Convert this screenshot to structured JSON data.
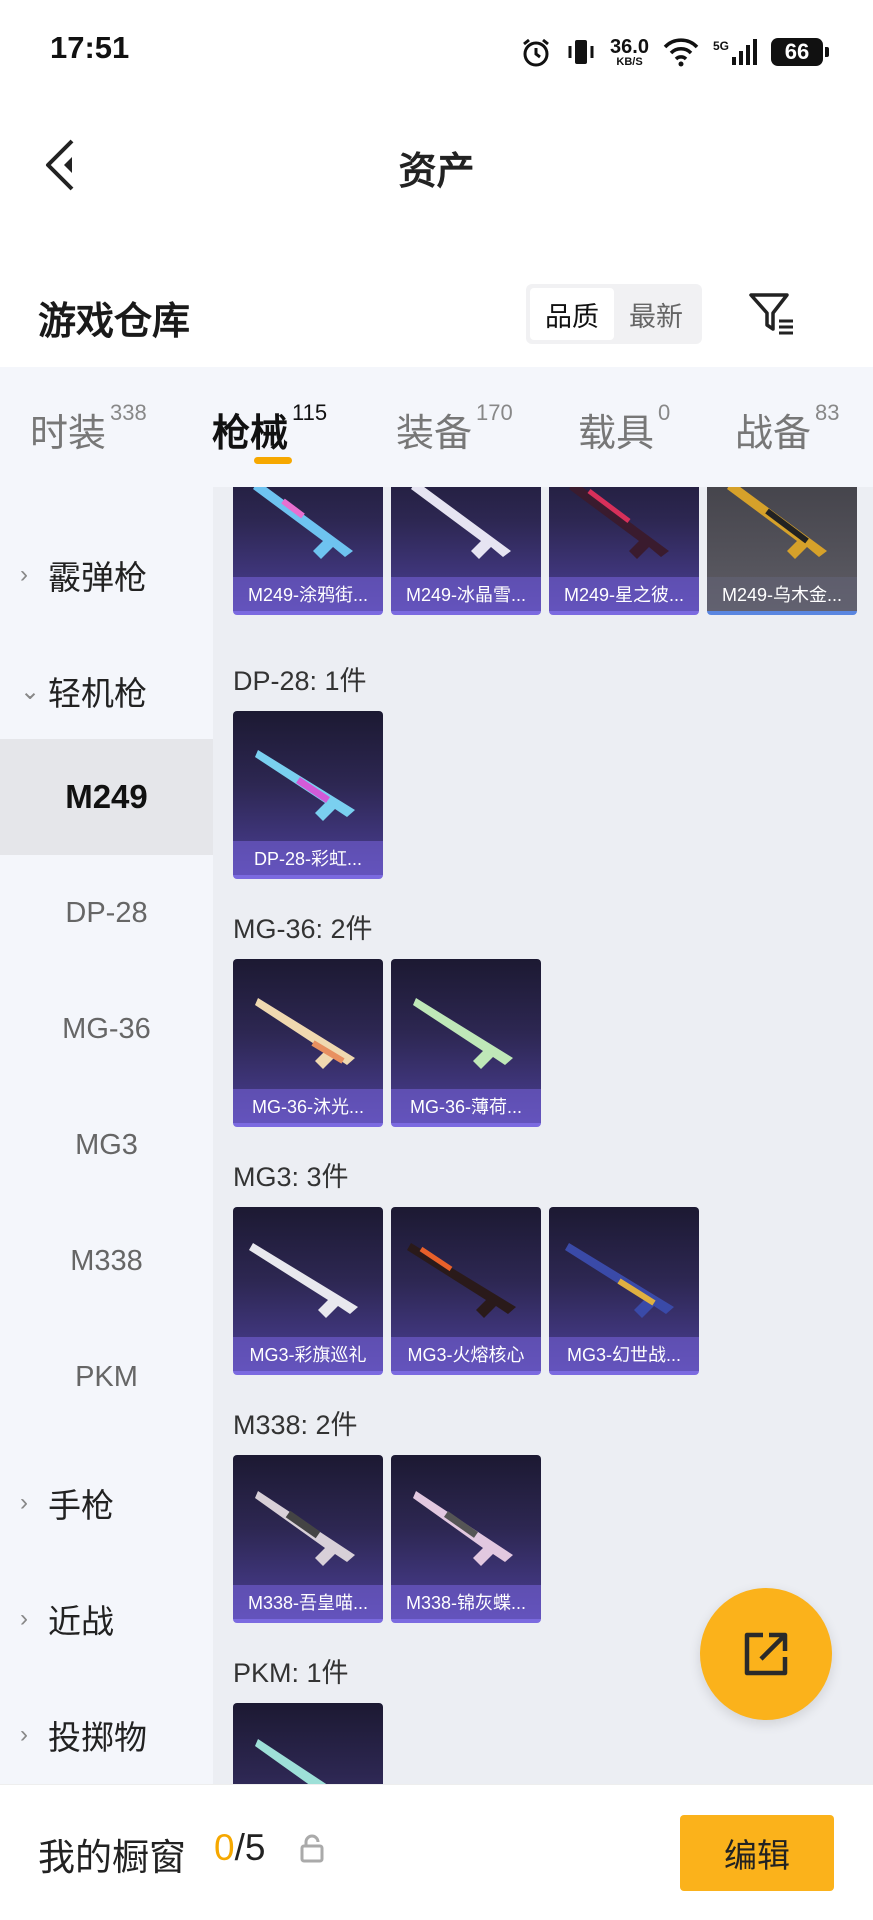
{
  "status_bar": {
    "time": "17:51",
    "speed_value": "36.0",
    "speed_unit": "KB/S",
    "network": "5G",
    "battery": "66"
  },
  "nav": {
    "title": "资产"
  },
  "header": {
    "title": "游戏仓库",
    "sort_options": [
      "品质",
      "最新"
    ],
    "sort_active": "品质"
  },
  "tabs": [
    {
      "label": "时装",
      "count": "338"
    },
    {
      "label": "枪械",
      "count": "115",
      "active": true
    },
    {
      "label": "装备",
      "count": "170"
    },
    {
      "label": "载具",
      "count": "0"
    },
    {
      "label": "战备",
      "count": "83"
    }
  ],
  "sidebar": {
    "categories": [
      {
        "label": "霰弹枪"
      },
      {
        "label": "轻机枪",
        "expanded": true
      },
      {
        "label": "手枪"
      },
      {
        "label": "近战"
      },
      {
        "label": "投掷物"
      }
    ],
    "subitems": [
      "M249",
      "DP-28",
      "MG-36",
      "MG3",
      "M338",
      "PKM"
    ],
    "active_subitem": "M249"
  },
  "sections": [
    {
      "title": "",
      "items": [
        "M249-涂鸦街...",
        "M249-冰晶雪...",
        "M249-星之彼...",
        "M249-乌木金..."
      ]
    },
    {
      "title": "DP-28: 1件",
      "items": [
        "DP-28-彩虹..."
      ]
    },
    {
      "title": "MG-36: 2件",
      "items": [
        "MG-36-沐光...",
        "MG-36-薄荷..."
      ]
    },
    {
      "title": "MG3: 3件",
      "items": [
        "MG3-彩旗巡礼",
        "MG3-火熔核心",
        "MG3-幻世战..."
      ]
    },
    {
      "title": "M338: 2件",
      "items": [
        "M338-吾皇喵...",
        "M338-锦灰蝶..."
      ]
    },
    {
      "title": "PKM: 1件",
      "items": [
        ""
      ]
    }
  ],
  "bottom_bar": {
    "title": "我的橱窗",
    "count_current": "0",
    "count_sep": "/",
    "count_total": "5",
    "edit_label": "编辑"
  },
  "colors": {
    "accent": "#fbb21b",
    "tab_indicator": "#f6a800"
  }
}
